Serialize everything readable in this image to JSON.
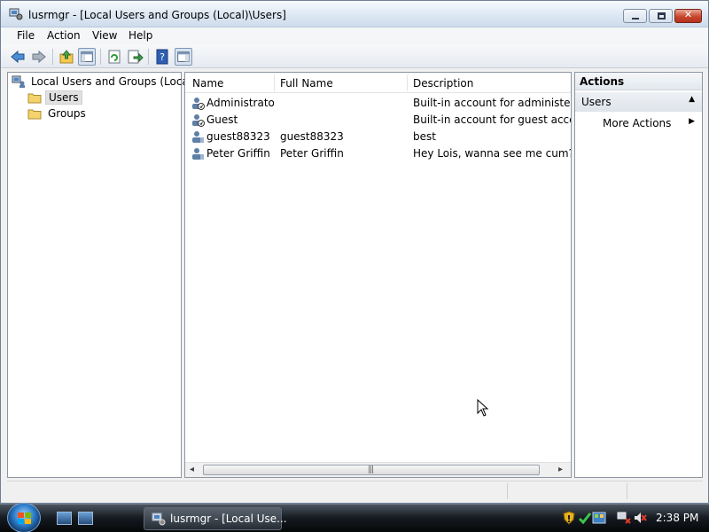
{
  "window": {
    "title": "lusrmgr - [Local Users and Groups (Local)\\Users]",
    "controls": {
      "minimize": "minimize",
      "maximize": "maximize",
      "close": "✕"
    }
  },
  "menu": [
    {
      "label": "File"
    },
    {
      "label": "Action"
    },
    {
      "label": "View"
    },
    {
      "label": "Help"
    }
  ],
  "toolbar": {
    "buttons": [
      "back-arrow-icon",
      "forward-arrow-icon",
      "up-folder-icon",
      "show-hide-tree-icon",
      "refresh-icon",
      "export-list-icon",
      "help-icon",
      "show-hide-action-pane-icon"
    ]
  },
  "tree": {
    "root": "Local Users and Groups (Local)",
    "children": [
      {
        "label": "Users",
        "selected": true
      },
      {
        "label": "Groups",
        "selected": false
      }
    ]
  },
  "list": {
    "columns": [
      "Name",
      "Full Name",
      "Description"
    ],
    "rows": [
      {
        "name": "Administrator",
        "full_name": "",
        "description": "Built-in account for administering"
      },
      {
        "name": "Guest",
        "full_name": "",
        "description": "Built-in account for guest access t"
      },
      {
        "name": "guest88323",
        "full_name": "guest88323",
        "description": "best"
      },
      {
        "name": "Peter Griffin",
        "full_name": "Peter Griffin",
        "description": "Hey Lois, wanna see me cum?"
      }
    ],
    "scroll": {
      "left": "◂",
      "right": "▸",
      "grip": "|||"
    }
  },
  "actions": {
    "header": "Actions",
    "group": "Users",
    "group_caret": "▲",
    "items": [
      {
        "label": "More Actions",
        "caret": "▶"
      }
    ]
  },
  "taskbar": {
    "task_label": "lusrmgr - [Local Use...",
    "clock": "2:38 PM"
  },
  "colors": {
    "title_gradient_top": "#f6f9fc",
    "title_gradient_bottom": "#cfdcec",
    "close_button": "#c8472e",
    "taskbar": "#161b22"
  }
}
